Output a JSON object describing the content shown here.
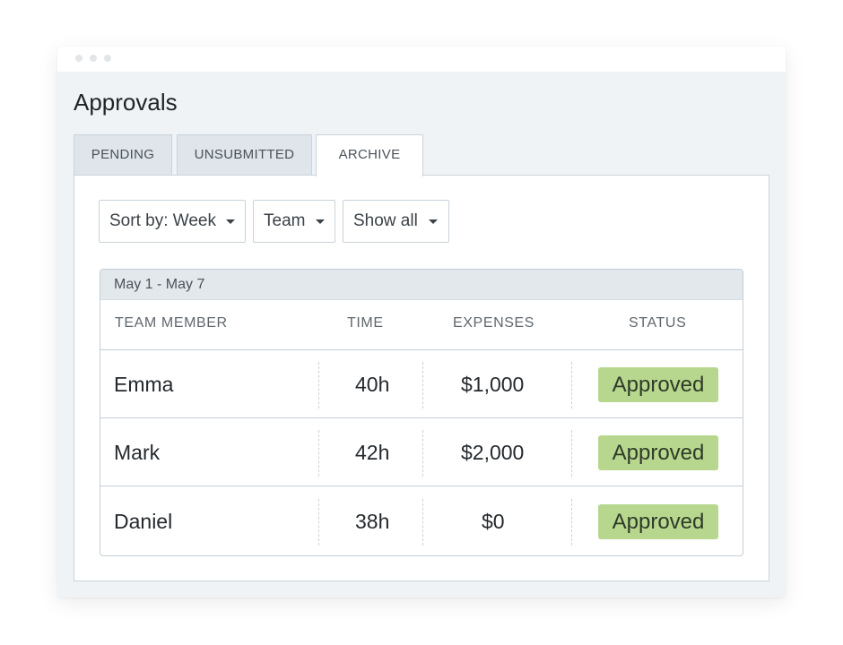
{
  "page": {
    "title": "Approvals"
  },
  "tabs": [
    {
      "label": "PENDING",
      "active": false
    },
    {
      "label": "UNSUBMITTED",
      "active": false
    },
    {
      "label": "ARCHIVE",
      "active": true
    }
  ],
  "filters": {
    "sort": "Sort by: Week",
    "team": "Team",
    "show": "Show all"
  },
  "table": {
    "date_range": "May 1 - May 7",
    "columns": [
      "TEAM MEMBER",
      "TIME",
      "EXPENSES",
      "STATUS"
    ],
    "rows": [
      {
        "member": "Emma",
        "time": "40h",
        "expenses": "$1,000",
        "status": "Approved"
      },
      {
        "member": "Mark",
        "time": "42h",
        "expenses": "$2,000",
        "status": "Approved"
      },
      {
        "member": "Daniel",
        "time": "38h",
        "expenses": "$0",
        "status": "Approved"
      }
    ]
  },
  "colors": {
    "approved_badge": "#b7d78e",
    "window_background": "#eff3f6",
    "active_tab": "#ffffff",
    "inactive_tab": "#dfe5ea"
  },
  "icons": {
    "dropdown_caret": "caret-down-icon",
    "window_controls": "window-dot-icon"
  }
}
